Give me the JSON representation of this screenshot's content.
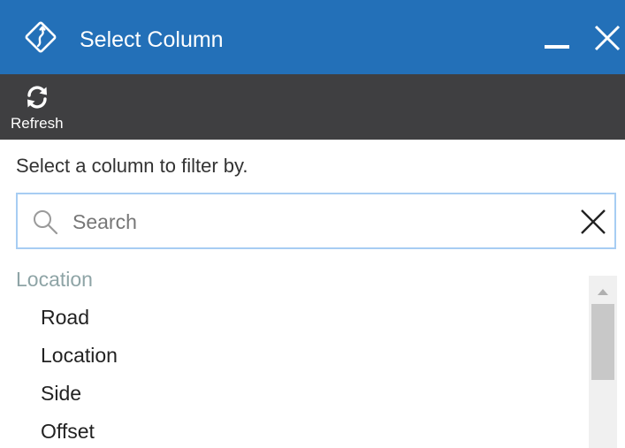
{
  "window": {
    "title": "Select Column"
  },
  "toolbar": {
    "refresh_label": "Refresh"
  },
  "instruction": "Select a column to filter by.",
  "search": {
    "placeholder": "Search",
    "value": ""
  },
  "group": {
    "header": "Location",
    "items": [
      "Road",
      "Location",
      "Side",
      "Offset"
    ]
  },
  "colors": {
    "titlebar": "#2370b8",
    "toolbar": "#3f3f41",
    "group_header": "#8ea4a6",
    "search_border": "#a7cdf3"
  },
  "icons": {
    "app": "road-sign-icon",
    "minimize": "minimize-icon",
    "close": "close-icon",
    "refresh": "refresh-icon",
    "search": "search-icon",
    "clear": "clear-icon",
    "scroll_up": "chevron-up-icon"
  }
}
